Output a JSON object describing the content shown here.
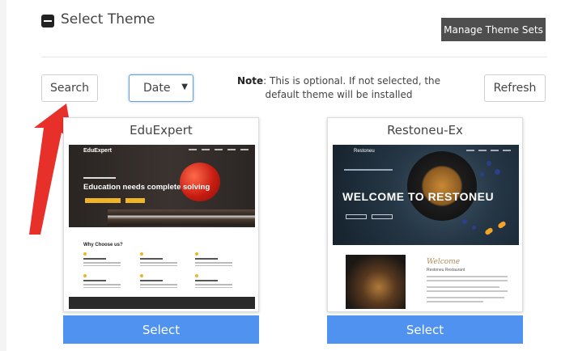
{
  "header": {
    "title": "Select Theme",
    "manage_label": "Manage Theme Sets"
  },
  "toolbar": {
    "search_label": "Search",
    "sort_value": "Date",
    "note_prefix": "Note",
    "note_text": ": This is optional. If not selected, the default theme will be installed",
    "refresh_label": "Refresh"
  },
  "themes": [
    {
      "name": "EduExpert",
      "select_label": "Select",
      "preview": {
        "brand": "EduExpert",
        "headline": "Education needs complete solving",
        "section_title": "Why Choose us?"
      }
    },
    {
      "name": "Restoneu-Ex",
      "select_label": "Select",
      "preview": {
        "brand": "Restoneu",
        "headline": "WELCOME TO RESTONEU",
        "welcome": "Welcome",
        "subtitle": "Restoneu Restaurant"
      }
    }
  ],
  "colors": {
    "select_button": "#4f92f0",
    "manage_button": "#4e4e4e",
    "annotation_arrow": "#e8302a"
  },
  "icons": {
    "collapse": "minus-square-icon",
    "dropdown": "caret-down-icon",
    "annotation": "red-arrow-icon"
  }
}
